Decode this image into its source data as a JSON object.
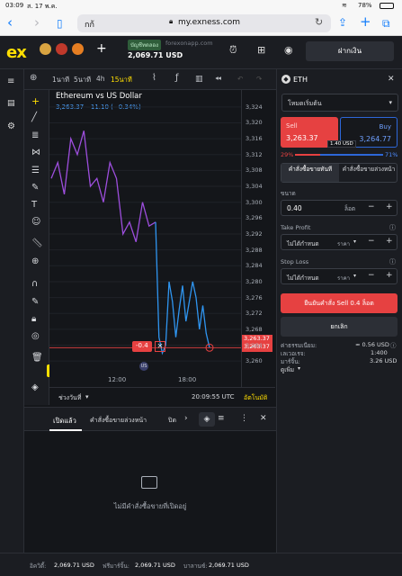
{
  "status": {
    "time": "03:09",
    "date": "ส. 17 พ.ค.",
    "battery": "78%"
  },
  "browser": {
    "tab_text": "กก้",
    "url": "my.exness.com"
  },
  "topbar": {
    "logo": "ex",
    "account_type": "บัญชีทดลอง",
    "account_site": "forexonapp.com",
    "balance": "2,069.71 USD",
    "deposit_label": "ฝากเงิน"
  },
  "chart_toolbar": {
    "tf_1m": "1นาที",
    "tf_5m": "5นาที",
    "tf_4h": "4h",
    "tf_15m": "15นาที"
  },
  "chart_data": {
    "type": "line",
    "title": "Ethereum vs US Dollar",
    "price_info": "3,263.37",
    "change_info": "−11.10 (−0.34%)",
    "x_ticks": [
      "12:00",
      "18:00"
    ],
    "y_ticks": [
      3324,
      3320,
      3316,
      3312,
      3308,
      3304,
      3300,
      3296,
      3292,
      3288,
      3284,
      3280,
      3276,
      3272,
      3268,
      3264,
      3260
    ],
    "ylim": [
      3258,
      3326
    ],
    "series": [
      {
        "color": "#9d4edd",
        "values": [
          3306,
          3310,
          3302,
          3316,
          3312,
          3318,
          3304,
          3306,
          3300,
          3310,
          3306,
          3292,
          3295,
          3290,
          3300,
          3294,
          3295
        ]
      },
      {
        "color": "#2f95f0",
        "values": [
          3295,
          3266,
          3262,
          3264,
          3280,
          3275,
          3266,
          3273,
          3279,
          3270,
          3275,
          3280,
          3276,
          3268,
          3274,
          3267,
          3263.37
        ]
      }
    ],
    "price_line_value": 3263.37,
    "price_labels": [
      "3,263.37",
      "3,263.37"
    ],
    "position_label": "-0.4"
  },
  "chart_footer": {
    "range_label": "ช่วงวันที่",
    "time_utc": "20:09:55 UTC",
    "auto_label": "อัตโนมัติ"
  },
  "panel": {
    "symbol": "ETH",
    "order_type": "โหมดเริ่มต้น",
    "sell_label": "Sell",
    "sell_price": "3,263.37",
    "buy_label": "Buy",
    "buy_price": "3,264.77",
    "spread": "1.40 USD",
    "pct_sell": "29%",
    "pct_buy": "71%",
    "tab_market": "คำสั่งซื้อขายทันที",
    "tab_pending": "คำสั่งซื้อขายล่วงหน้า",
    "volume_label": "ขนาด",
    "volume_value": "0.40",
    "volume_unit": "ล็อต",
    "tp_label": "Take Profit",
    "tp_value": "ไม่ได้กำหนด",
    "tp_unit": "ราคา",
    "sl_label": "Stop Loss",
    "sl_value": "ไม่ได้กำหนด",
    "sl_unit": "ราคา",
    "confirm_label": "ยืนยันคำสั่ง Sell 0.4 ล็อต",
    "cancel_label": "ยกเลิก",
    "fee_label": "ค่าธรรมเนียม:",
    "fee_value": "≈ 0.56 USD",
    "leverage_label": "เลเวอเรจ:",
    "leverage_value": "1:400",
    "margin_label": "มาร์จิ้น:",
    "margin_value": "3.26 USD",
    "more_label": "ดูเพิ่ม"
  },
  "bottom": {
    "tab_open": "เปิดแล้ว",
    "tab_pending": "คำสั่งซื้อขายล่วงหน้า",
    "tab_closed": "ปิด",
    "empty_text": "ไม่มีคำสั่งซื้อขายที่เปิดอยู่"
  },
  "footer": {
    "equity_label": "อิควิตี้:",
    "equity_value": "2,069.71 USD",
    "free_margin_label": "ฟรีมาร์จิ้น:",
    "free_margin_value": "2,069.71 USD",
    "balance_label": "บาลานซ์:",
    "balance_value": "2,069.71 USD"
  }
}
